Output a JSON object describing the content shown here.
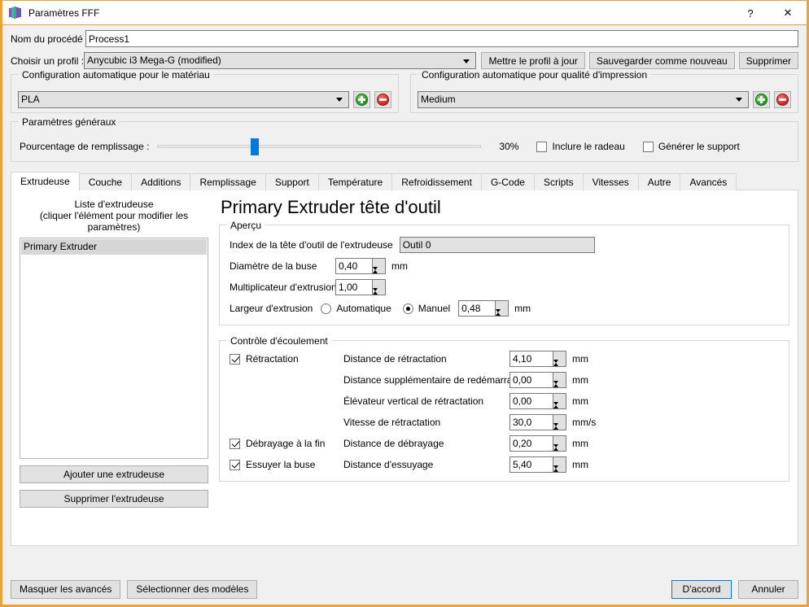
{
  "window": {
    "title": "Paramètres FFF",
    "icon": "app-logo-icon",
    "help_label": "?",
    "close_label": "✕",
    "border_color": "#e8a33d"
  },
  "top": {
    "process_name_label": "Nom du procédé :",
    "process_name_value": "Process1",
    "profile_label": "Choisir un profil :",
    "profile_value": "Anycubic i3 Mega-G (modified)",
    "update_profile_button": "Mettre le profil à jour",
    "save_as_new_button": "Sauvegarder comme nouveau",
    "delete_button": "Supprimer"
  },
  "material_group": {
    "caption": "Configuration automatique pour le matériau",
    "value": "PLA",
    "add_label": "+",
    "remove_label": "−"
  },
  "quality_group": {
    "caption": "Configuration automatique pour qualité d'impression",
    "value": "Medium",
    "add_label": "+",
    "remove_label": "−"
  },
  "general_group": {
    "caption": "Paramètres généraux",
    "infill_label": "Pourcentage de remplissage :",
    "infill_percent": "30%",
    "infill_value": 30,
    "raft_label": "Inclure le radeau",
    "raft_checked": false,
    "support_label": "Générer le support",
    "support_checked": false,
    "accent_color": "#0078d7"
  },
  "tabs": [
    {
      "label": "Extrudeuse",
      "active": true
    },
    {
      "label": "Couche",
      "active": false
    },
    {
      "label": "Additions",
      "active": false
    },
    {
      "label": "Remplissage",
      "active": false
    },
    {
      "label": "Support",
      "active": false
    },
    {
      "label": "Température",
      "active": false
    },
    {
      "label": "Refroidissement",
      "active": false
    },
    {
      "label": "G-Code",
      "active": false
    },
    {
      "label": "Scripts",
      "active": false
    },
    {
      "label": "Vitesses",
      "active": false
    },
    {
      "label": "Autre",
      "active": false
    },
    {
      "label": "Avancés",
      "active": false
    }
  ],
  "extruder_list": {
    "caption_line1": "Liste d'extrudeuse",
    "caption_line2": "(cliquer l'élément pour modifier les paramètres)",
    "items": [
      {
        "label": "Primary Extruder",
        "selected": true
      }
    ],
    "add_button": "Ajouter une extrudeuse",
    "remove_button": "Supprimer l'extrudeuse"
  },
  "page": {
    "title": "Primary Extruder tête d'outil"
  },
  "overview_group": {
    "caption": "Aperçu",
    "toolhead_index_label": "Index de la tête d'outil de l'extrudeuse",
    "toolhead_index_value": "Outil 0",
    "nozzle_diameter_label": "Diamètre de la buse",
    "nozzle_diameter_value": "0,40",
    "nozzle_diameter_unit": "mm",
    "extrusion_multiplier_label": "Multiplicateur d'extrusion",
    "extrusion_multiplier_value": "1,00",
    "extrusion_width_label": "Largeur d'extrusion",
    "extrusion_width_auto_label": "Automatique",
    "extrusion_width_auto_selected": false,
    "extrusion_width_manual_label": "Manuel",
    "extrusion_width_manual_selected": true,
    "extrusion_width_value": "0,48",
    "extrusion_width_unit": "mm"
  },
  "flow_group": {
    "caption": "Contrôle d'écoulement",
    "retraction_checkbox_label": "Rétractation",
    "retraction_checked": true,
    "retraction_distance_label": "Distance de rétractation",
    "retraction_distance_value": "4,10",
    "retraction_distance_unit": "mm",
    "extra_restart_label": "Distance supplémentaire de redémarrage",
    "extra_restart_value": "0,00",
    "extra_restart_unit": "mm",
    "vertical_lift_label": "Élévateur vertical de rétractation",
    "vertical_lift_value": "0,00",
    "vertical_lift_unit": "mm",
    "retraction_speed_label": "Vitesse de rétractation",
    "retraction_speed_value": "30,0",
    "retraction_speed_unit": "mm/s",
    "coast_checkbox_label": "Débrayage à la fin",
    "coast_checked": true,
    "coast_distance_label": "Distance de débrayage",
    "coast_distance_value": "0,20",
    "coast_distance_unit": "mm",
    "wipe_checkbox_label": "Essuyer la buse",
    "wipe_checked": true,
    "wipe_distance_label": "Distance d'essuyage",
    "wipe_distance_value": "5,40",
    "wipe_distance_unit": "mm"
  },
  "bottom": {
    "hide_advanced_button": "Masquer les avancés",
    "select_models_button": "Sélectionner des modèles",
    "ok_button": "D'accord",
    "cancel_button": "Annuler"
  }
}
